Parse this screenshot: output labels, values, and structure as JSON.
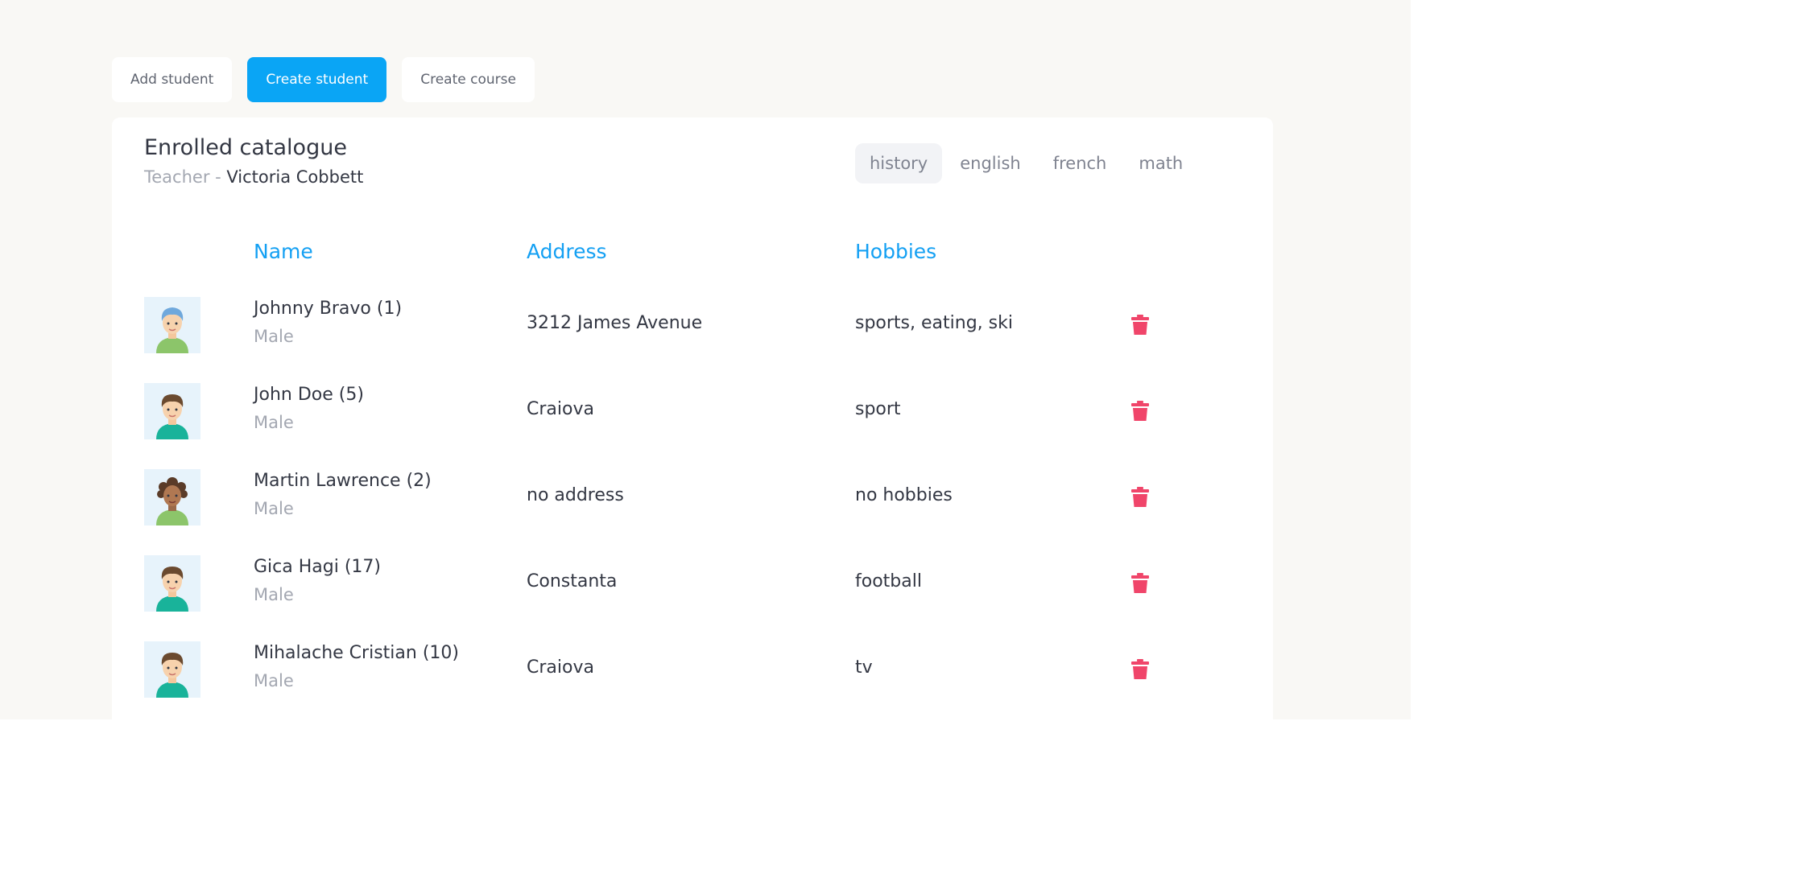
{
  "toolbar": {
    "add_student_label": "Add student",
    "create_student_label": "Create student",
    "create_course_label": "Create course"
  },
  "catalogue": {
    "title": "Enrolled catalogue",
    "teacher_prefix": "Teacher - ",
    "teacher_name": "Victoria Cobbett"
  },
  "tabs": [
    {
      "label": "history",
      "active": true
    },
    {
      "label": "english",
      "active": false
    },
    {
      "label": "french",
      "active": false
    },
    {
      "label": "math",
      "active": false
    }
  ],
  "table": {
    "headers": {
      "name": "Name",
      "address": "Address",
      "hobbies": "Hobbies"
    },
    "rows": [
      {
        "name": "Johnny Bravo (1)",
        "gender": "Male",
        "address": "3212 James Avenue",
        "hobbies": "sports, eating, ski",
        "avatar": "avatar-blue-hair"
      },
      {
        "name": "John Doe (5)",
        "gender": "Male",
        "address": "Craiova",
        "hobbies": "sport",
        "avatar": "avatar-brown-hair"
      },
      {
        "name": "Martin Lawrence (2)",
        "gender": "Male",
        "address": "no address",
        "hobbies": "no hobbies",
        "avatar": "avatar-curly-hair"
      },
      {
        "name": "Gica Hagi (17)",
        "gender": "Male",
        "address": "Constanta",
        "hobbies": "football",
        "avatar": "avatar-brown-hair"
      },
      {
        "name": "Mihalache Cristian (10)",
        "gender": "Male",
        "address": "Craiova",
        "hobbies": "tv",
        "avatar": "avatar-brown-hair"
      }
    ]
  },
  "colors": {
    "accent": "#0aa5f5",
    "header": "#14a0f3",
    "delete": "#f0456a",
    "background": "#f9f8f5"
  }
}
